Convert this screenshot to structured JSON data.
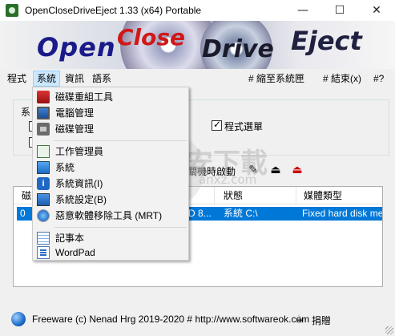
{
  "window": {
    "title": "OpenCloseDriveEject 1.33  (x64) Portable",
    "minimize": "—",
    "maximize": "☐",
    "close": "✕"
  },
  "banner": {
    "word1": "Open",
    "word2": "Close",
    "word3": "Drive",
    "word4": "Eject"
  },
  "menubar": {
    "items": [
      {
        "label": "程式"
      },
      {
        "label": "系統"
      },
      {
        "label": "資訊"
      },
      {
        "label": "語系"
      }
    ],
    "shrink": "# 縮至系統匣",
    "exit": "# 結束(x)",
    "help": "#?"
  },
  "options": {
    "group_stub": "系",
    "program_menu": "程式選單",
    "program_menu_checked": true,
    "startup_text": "關機時啟動"
  },
  "list": {
    "columns": [
      "磁",
      "狀態",
      "媒體類型"
    ],
    "row": {
      "drive": "0",
      "name": "D 8...",
      "status": "系統 C:\\",
      "media": "Fixed hard disk medi"
    }
  },
  "dropdown": {
    "items": [
      {
        "label": "磁碟重組工具",
        "icon": "defrag-icon"
      },
      {
        "label": "電腦管理",
        "icon": "computer-management-icon"
      },
      {
        "label": "磁碟管理",
        "icon": "disk-management-icon"
      },
      {
        "label": "工作管理員",
        "icon": "task-manager-icon"
      },
      {
        "label": "系統",
        "icon": "system-icon"
      },
      {
        "label": "系統資訊(I)",
        "icon": "system-info-icon"
      },
      {
        "label": "系統設定(B)",
        "icon": "system-config-icon"
      },
      {
        "label": "惡意軟體移除工具 (MRT)",
        "icon": "mrt-icon"
      },
      {
        "label": "記事本",
        "icon": "notepad-icon"
      },
      {
        "label": "WordPad",
        "icon": "wordpad-icon"
      }
    ]
  },
  "status": {
    "text": "Freeware (c) Nenad Hrg 2019-2020 # http://www.softwareok.com",
    "donate": "捐贈"
  },
  "watermark": {
    "text": "安下載",
    "sub": "anxz.com"
  }
}
